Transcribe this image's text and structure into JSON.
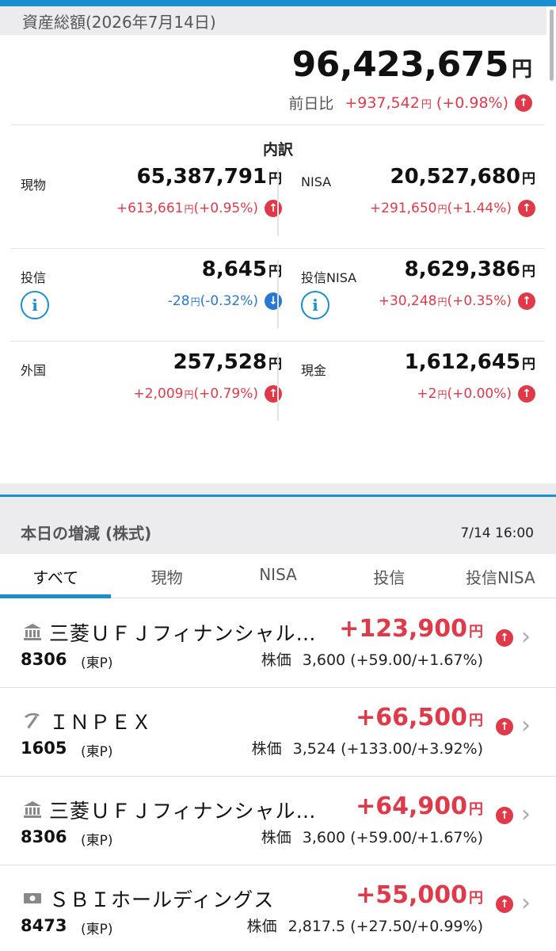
{
  "summary": {
    "header": "資産総額(2026年7月14日)",
    "total": "96,423,675",
    "yen": "円",
    "prev_label": "前日比",
    "prev_change": "+937,542",
    "prev_pct": "(+0.98%)"
  },
  "breakdown": {
    "title": "内訳",
    "items": [
      {
        "name": "現物",
        "amount": "65,387,791",
        "change": "+613,661",
        "pct": "(+0.95%)",
        "direction": "up"
      },
      {
        "name": "NISA",
        "amount": "20,527,680",
        "change": "+291,650",
        "pct": "(+1.44%)",
        "direction": "up"
      },
      {
        "name": "投信",
        "amount": "8,645",
        "change": "-28",
        "pct": "(-0.32%)",
        "direction": "down"
      },
      {
        "name": "投信NISA",
        "amount": "8,629,386",
        "change": "+30,248",
        "pct": "(+0.35%)",
        "direction": "up"
      },
      {
        "name": "外国",
        "amount": "257,528",
        "change": "+2,009",
        "pct": "(+0.79%)",
        "direction": "up"
      },
      {
        "name": "現金",
        "amount": "1,612,645",
        "change": "+2",
        "pct": "(+0.00%)",
        "direction": "up"
      }
    ]
  },
  "section": {
    "title": "本日の増減 (株式)",
    "time": "7/14 16:00"
  },
  "tabs": [
    "すべて",
    "現物",
    "NISA",
    "投信",
    "投信NISA"
  ],
  "active_tab": "すべて",
  "stocks": [
    {
      "icon": "bank-icon",
      "name": "三菱ＵＦＪフィナンシャル…",
      "pnl": "+123,900",
      "code": "8306",
      "market": "(東P)",
      "price_label": "株価",
      "price": "3,600 (+59.00/+1.67%)"
    },
    {
      "icon": "pickaxe-icon",
      "name": "ＩＮＰＥＸ",
      "pnl": "+66,500",
      "code": "1605",
      "market": "(東P)",
      "price_label": "株価",
      "price": "3,524 (+133.00/+3.92%)"
    },
    {
      "icon": "bank-icon",
      "name": "三菱ＵＦＪフィナンシャル・…",
      "pnl": "+64,900",
      "code": "8306",
      "market": "(東P)",
      "price_label": "株価",
      "price": "3,600 (+59.00/+1.67%)"
    },
    {
      "icon": "money-icon",
      "name": "ＳＢＩホールディングス",
      "pnl": "+55,000",
      "code": "8473",
      "market": "(東P)",
      "price_label": "株価",
      "price": "2,817.5 (+27.50/+0.99%)"
    }
  ],
  "colors": {
    "accent": "#1a8fd0",
    "up": "#e03a4a",
    "down": "#2a78d0",
    "band": "#ececef"
  }
}
